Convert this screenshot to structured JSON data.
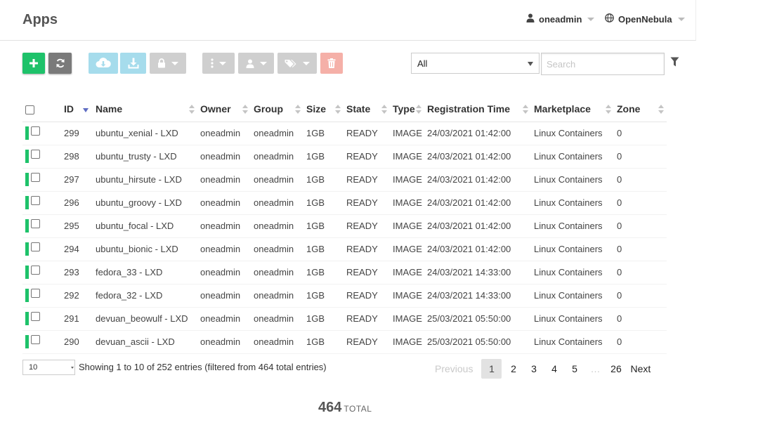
{
  "header": {
    "title": "Apps",
    "user": "oneadmin",
    "zone": "OpenNebula"
  },
  "toolbar": {
    "create_icon": "plus-icon",
    "refresh_icon": "refresh-icon",
    "export_icon": "cloud-download-icon",
    "download_icon": "download-icon",
    "lock_icon": "lock-icon",
    "more_icon": "ellipsis-vertical-icon",
    "owner_icon": "user-icon",
    "labels_icon": "tags-icon",
    "delete_icon": "trash-icon"
  },
  "filter": {
    "selected": "All",
    "search_placeholder": "Search",
    "search_value": ""
  },
  "table": {
    "columns": [
      "ID",
      "Name",
      "Owner",
      "Group",
      "Size",
      "State",
      "Type",
      "Registration Time",
      "Marketplace",
      "Zone"
    ],
    "sorted_column": "ID",
    "rows": [
      {
        "id": "299",
        "name": "ubuntu_xenial - LXD",
        "owner": "oneadmin",
        "group": "oneadmin",
        "size": "1GB",
        "state": "READY",
        "type": "IMAGE",
        "registration_time": "24/03/2021 01:42:00",
        "marketplace": "Linux Containers",
        "zone": "0"
      },
      {
        "id": "298",
        "name": "ubuntu_trusty - LXD",
        "owner": "oneadmin",
        "group": "oneadmin",
        "size": "1GB",
        "state": "READY",
        "type": "IMAGE",
        "registration_time": "24/03/2021 01:42:00",
        "marketplace": "Linux Containers",
        "zone": "0"
      },
      {
        "id": "297",
        "name": "ubuntu_hirsute - LXD",
        "owner": "oneadmin",
        "group": "oneadmin",
        "size": "1GB",
        "state": "READY",
        "type": "IMAGE",
        "registration_time": "24/03/2021 01:42:00",
        "marketplace": "Linux Containers",
        "zone": "0"
      },
      {
        "id": "296",
        "name": "ubuntu_groovy - LXD",
        "owner": "oneadmin",
        "group": "oneadmin",
        "size": "1GB",
        "state": "READY",
        "type": "IMAGE",
        "registration_time": "24/03/2021 01:42:00",
        "marketplace": "Linux Containers",
        "zone": "0"
      },
      {
        "id": "295",
        "name": "ubuntu_focal - LXD",
        "owner": "oneadmin",
        "group": "oneadmin",
        "size": "1GB",
        "state": "READY",
        "type": "IMAGE",
        "registration_time": "24/03/2021 01:42:00",
        "marketplace": "Linux Containers",
        "zone": "0"
      },
      {
        "id": "294",
        "name": "ubuntu_bionic - LXD",
        "owner": "oneadmin",
        "group": "oneadmin",
        "size": "1GB",
        "state": "READY",
        "type": "IMAGE",
        "registration_time": "24/03/2021 01:42:00",
        "marketplace": "Linux Containers",
        "zone": "0"
      },
      {
        "id": "293",
        "name": "fedora_33 - LXD",
        "owner": "oneadmin",
        "group": "oneadmin",
        "size": "1GB",
        "state": "READY",
        "type": "IMAGE",
        "registration_time": "24/03/2021 14:33:00",
        "marketplace": "Linux Containers",
        "zone": "0"
      },
      {
        "id": "292",
        "name": "fedora_32 - LXD",
        "owner": "oneadmin",
        "group": "oneadmin",
        "size": "1GB",
        "state": "READY",
        "type": "IMAGE",
        "registration_time": "24/03/2021 14:33:00",
        "marketplace": "Linux Containers",
        "zone": "0"
      },
      {
        "id": "291",
        "name": "devuan_beowulf - LXD",
        "owner": "oneadmin",
        "group": "oneadmin",
        "size": "1GB",
        "state": "READY",
        "type": "IMAGE",
        "registration_time": "25/03/2021 05:50:00",
        "marketplace": "Linux Containers",
        "zone": "0"
      },
      {
        "id": "290",
        "name": "devuan_ascii - LXD",
        "owner": "oneadmin",
        "group": "oneadmin",
        "size": "1GB",
        "state": "READY",
        "type": "IMAGE",
        "registration_time": "25/03/2021 05:50:00",
        "marketplace": "Linux Containers",
        "zone": "0"
      }
    ]
  },
  "footer": {
    "page_length": "10",
    "info": "Showing 1 to 10 of 252 entries (filtered from 464 total entries)",
    "pagination": {
      "previous": "Previous",
      "pages": [
        "1",
        "2",
        "3",
        "4",
        "5"
      ],
      "ellipsis": "…",
      "last": "26",
      "next": "Next",
      "current": "1"
    },
    "total_count": "464",
    "total_label": "TOTAL"
  },
  "colors": {
    "create": "#1ec26a",
    "refresh": "#7a7a7a",
    "cloud_buttons": "#a6dcec",
    "disabled_buttons": "#cfcfcf",
    "delete": "#f5b0a8",
    "status_ready": "#1ec26a",
    "sort_active": "#5f6dc3"
  }
}
